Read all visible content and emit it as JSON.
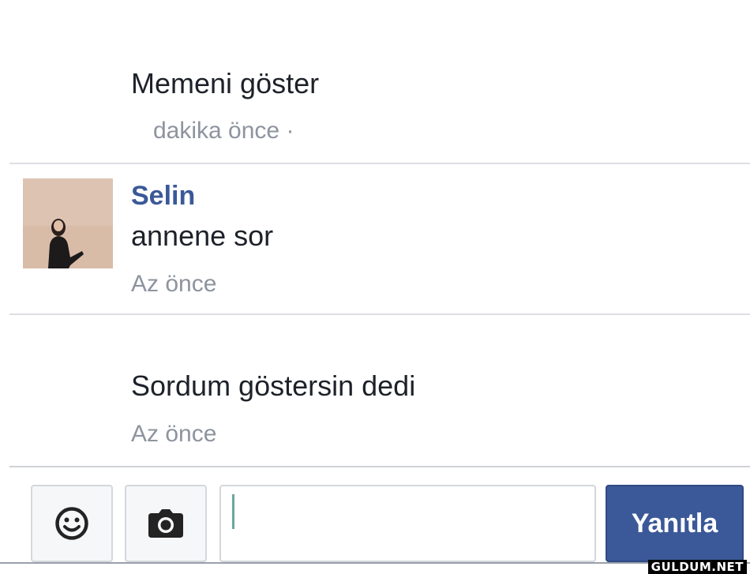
{
  "comments": [
    {
      "text": "Memeni göster",
      "time": "dakika önce ·"
    },
    {
      "author": "Selin",
      "text": "annene sor",
      "time": "Az önce"
    },
    {
      "text": "Sordum göstersin dedi",
      "time": "Az önce"
    }
  ],
  "reply_bar": {
    "emoji_icon": "smiley-face-icon",
    "camera_icon": "camera-icon",
    "input_value": "",
    "reply_label": "Yanıtla"
  },
  "watermark": "GULDUM.NET",
  "colors": {
    "name_blue": "#3b5998",
    "button_blue": "#3b5998",
    "meta_gray": "#8d949e"
  }
}
